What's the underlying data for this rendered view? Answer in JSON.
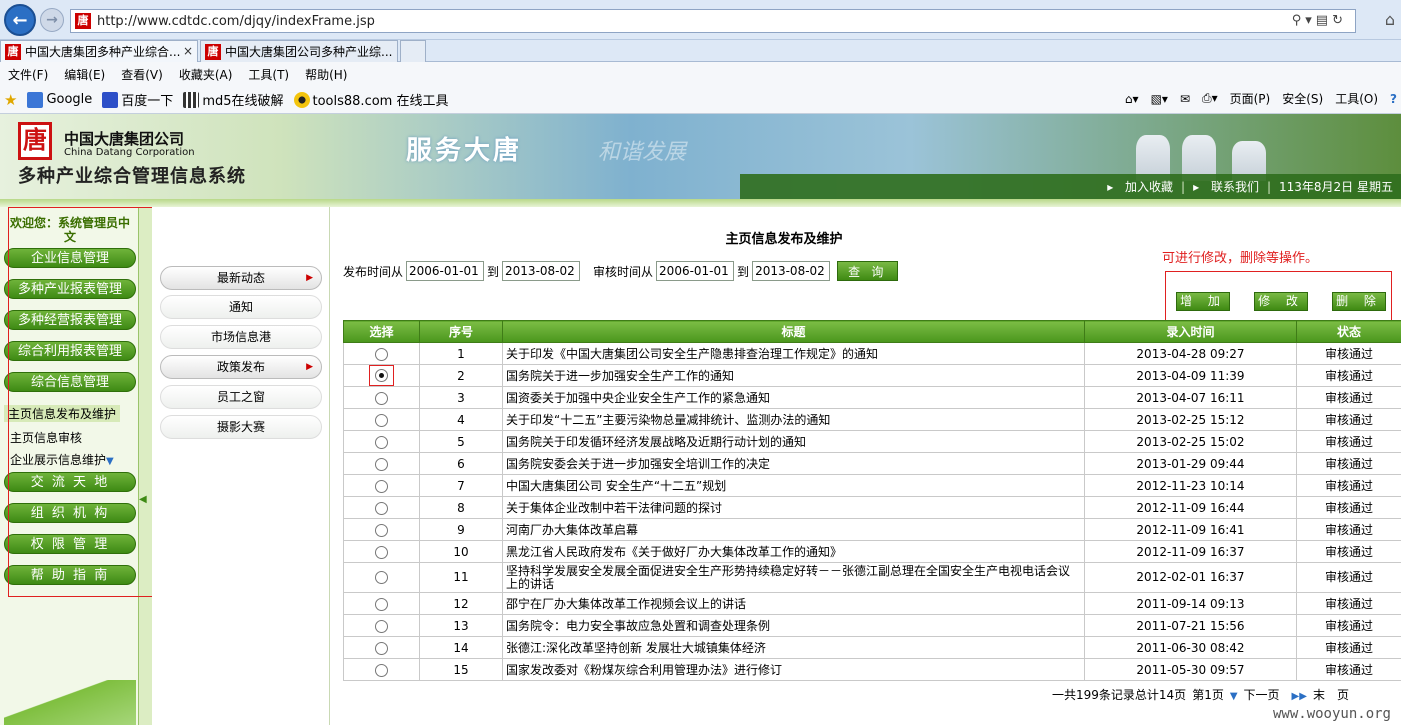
{
  "browser": {
    "url": "http://www.cdtdc.com/djqy/indexFrame.jsp",
    "site_icon_char": "唐",
    "tabs": [
      {
        "label": "中国大唐集团多种产业综合...",
        "close": "×"
      },
      {
        "label": "中国大唐集团公司多种产业综..."
      }
    ],
    "menu": [
      "文件(F)",
      "编辑(E)",
      "查看(V)",
      "收藏夹(A)",
      "工具(T)",
      "帮助(H)"
    ],
    "favorites": [
      {
        "label": "Google",
        "icon": "google-icon"
      },
      {
        "label": "百度一下",
        "icon": "baidu-paw-icon"
      },
      {
        "label": "md5在线破解",
        "icon": "grid-icon"
      },
      {
        "label": "tools88.com 在线工具",
        "icon": "radiation-icon"
      }
    ],
    "commands": [
      "页面(P)",
      "安全(S)",
      "工具(O)"
    ]
  },
  "header": {
    "logo_char": "唐",
    "corp_cn": "中国大唐集团公司",
    "corp_en": "China Datang Corporation",
    "system_title": "多种产业综合管理信息系统",
    "slogan": "服务大唐",
    "slogan2": "和谐发展",
    "links": [
      "加入收藏",
      "联系我们"
    ],
    "separator": "|",
    "date": "113年8月2日 星期五"
  },
  "sidebar": {
    "welcome": "欢迎您：系统管理员中文",
    "items_top": [
      "企业信息管理",
      "多种产业报表管理",
      "多种经营报表管理",
      "综合利用报表管理",
      "综合信息管理"
    ],
    "sub_items": [
      "主页信息发布及维护",
      "主页信息审核",
      "企业展示信息维护"
    ],
    "items_bottom": [
      "交 流 天 地",
      "组 织 机 构",
      "权 限 管 理",
      "帮 助 指 南"
    ]
  },
  "subnav": {
    "items": [
      {
        "label": "最新动态",
        "has_arrow": true
      },
      {
        "label": "通知"
      },
      {
        "label": "市场信息港"
      },
      {
        "label": "政策发布",
        "has_arrow": true
      },
      {
        "label": "员工之窗"
      },
      {
        "label": "摄影大赛"
      }
    ],
    "arrow": "▶"
  },
  "main": {
    "title": "主页信息发布及维护",
    "hint": "可进行修改，删除等操作。",
    "filters": {
      "publish_from_label": "发布时间从",
      "publish_from": "2006-01-01",
      "to_label": "到",
      "publish_to": "2013-08-02",
      "audit_from_label": "审核时间从",
      "audit_from": "2006-01-01",
      "audit_to": "2013-08-02",
      "query_label": "查 询"
    },
    "actions": [
      "增 加",
      "修 改",
      "删 除"
    ],
    "columns": [
      "选择",
      "序号",
      "标题",
      "录入时间",
      "状态"
    ],
    "rows": [
      {
        "no": "1",
        "title": "关于印发《中国大唐集团公司安全生产隐患排查治理工作规定》的通知",
        "time": "2013-04-28 09:27",
        "status": "审核通过"
      },
      {
        "no": "2",
        "title": "国务院关于进一步加强安全生产工作的通知",
        "time": "2013-04-09 11:39",
        "status": "审核通过",
        "selected": true
      },
      {
        "no": "3",
        "title": "国资委关于加强中央企业安全生产工作的紧急通知",
        "time": "2013-04-07 16:11",
        "status": "审核通过"
      },
      {
        "no": "4",
        "title": "关于印发“十二五”主要污染物总量减排统计、监测办法的通知",
        "time": "2013-02-25 15:12",
        "status": "审核通过"
      },
      {
        "no": "5",
        "title": "国务院关于印发循环经济发展战略及近期行动计划的通知",
        "time": "2013-02-25 15:02",
        "status": "审核通过"
      },
      {
        "no": "6",
        "title": "国务院安委会关于进一步加强安全培训工作的决定",
        "time": "2013-01-29 09:44",
        "status": "审核通过"
      },
      {
        "no": "7",
        "title": "中国大唐集团公司 安全生产“十二五”规划",
        "time": "2012-11-23 10:14",
        "status": "审核通过"
      },
      {
        "no": "8",
        "title": "关于集体企业改制中若干法律问题的探讨",
        "time": "2012-11-09 16:44",
        "status": "审核通过"
      },
      {
        "no": "9",
        "title": "河南厂办大集体改革启幕",
        "time": "2012-11-09 16:41",
        "status": "审核通过"
      },
      {
        "no": "10",
        "title": "黑龙江省人民政府发布《关于做好厂办大集体改革工作的通知》",
        "time": "2012-11-09 16:37",
        "status": "审核通过"
      },
      {
        "no": "11",
        "title": "坚持科学发展安全发展全面促进安全生产形势持续稳定好转－－张德江副总理在全国安全生产电视电话会议上的讲话",
        "time": "2012-02-01 16:37",
        "status": "审核通过",
        "tall": true
      },
      {
        "no": "12",
        "title": "邵宁在厂办大集体改革工作视频会议上的讲话",
        "time": "2011-09-14 09:13",
        "status": "审核通过"
      },
      {
        "no": "13",
        "title": "国务院令：电力安全事故应急处置和调查处理条例",
        "time": "2011-07-21 15:56",
        "status": "审核通过"
      },
      {
        "no": "14",
        "title": "张德江:深化改革坚持创新 发展壮大城镇集体经济",
        "time": "2011-06-30 08:42",
        "status": "审核通过"
      },
      {
        "no": "15",
        "title": "国家发改委对《粉煤灰综合利用管理办法》进行修订",
        "time": "2011-05-30 09:57",
        "status": "审核通过"
      }
    ],
    "pager": {
      "summary": "一共199条记录总计14页",
      "current": "第1页",
      "next": "下一页",
      "last": "末　页"
    }
  },
  "watermark": "www.wooyun.org",
  "colors": {
    "green_dark": "#3e8a14",
    "green_light": "#7cbd45",
    "red_annotation": "#e02020",
    "ie_blue": "#2b6fc4"
  }
}
